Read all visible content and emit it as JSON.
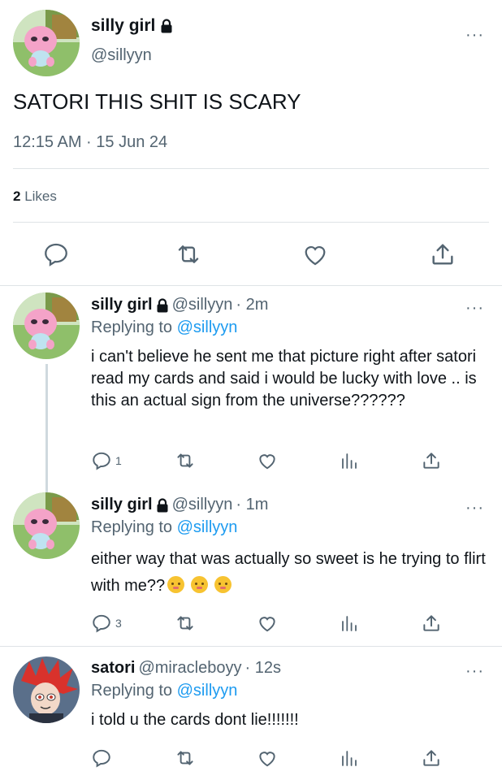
{
  "main": {
    "name": "silly girl",
    "handle": "@sillyyn",
    "text": "SATORI THIS SHIT IS SCARY",
    "time": "12:15 AM · 15 Jun 24",
    "likes_count": "2",
    "likes_label": "Likes",
    "more": "···"
  },
  "replies": [
    {
      "name": "silly girl",
      "handle": "@sillyyn",
      "time": "· 2m",
      "replying_prefix": "Replying to",
      "replying_to": "@sillyyn",
      "text": "i can't believe he sent me that picture right after satori read my cards and said i would be lucky with love .. is this an actual sign from the universe??????",
      "reply_count": "1",
      "more": "···"
    },
    {
      "name": "silly girl",
      "handle": "@sillyyn",
      "time": "· 1m",
      "replying_prefix": "Replying to",
      "replying_to": "@sillyyn",
      "text": "either way that was actually so sweet is he trying to flirt with me??",
      "emojis": [
        "blush-kiss-emoji",
        "blush-kiss-emoji",
        "blush-kiss-emoji"
      ],
      "reply_count": "3",
      "more": "···"
    },
    {
      "name": "satori",
      "handle": "@miracleboyy",
      "time": "· 12s",
      "replying_prefix": "Replying to",
      "replying_to": "@sillyyn",
      "text": "i told u the cards dont lie!!!!!!!",
      "reply_count": "",
      "more": "···"
    }
  ],
  "colors": {
    "accent": "#1d9bf0",
    "muted": "#536471",
    "text": "#0f1419",
    "divider": "#dfe3e6"
  }
}
